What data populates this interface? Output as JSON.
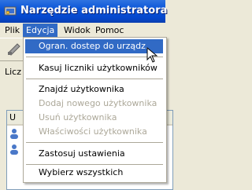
{
  "window": {
    "title": "Narzędzie administratora"
  },
  "menubar": {
    "plik": "Plik",
    "edycja": "Edycja",
    "widok": "Widok",
    "pomoc": "Pomoc"
  },
  "main": {
    "count_label": "Licz",
    "list_header": "U"
  },
  "dropdown": {
    "items": [
      {
        "label": "Ogran. dostep do urządz.",
        "enabled": true,
        "highlighted": true
      },
      {
        "label": "Kasuj liczniki użytkowników",
        "enabled": true
      },
      {
        "label": "Znajdź użytkownika",
        "enabled": true
      },
      {
        "label": "Dodaj nowego użytkownika",
        "enabled": false
      },
      {
        "label": "Usuń użytkownika",
        "enabled": false
      },
      {
        "label": "Właściwości użytkownika",
        "enabled": false
      },
      {
        "label": "Zastosuj ustawienia",
        "enabled": true
      },
      {
        "label": "Wybierz wszystkich",
        "enabled": true
      }
    ]
  },
  "colors": {
    "highlight": "#316ac5",
    "menu_bg": "#ece9d8",
    "title_bar": "#0a55d8",
    "disabled_text": "#aca899"
  }
}
